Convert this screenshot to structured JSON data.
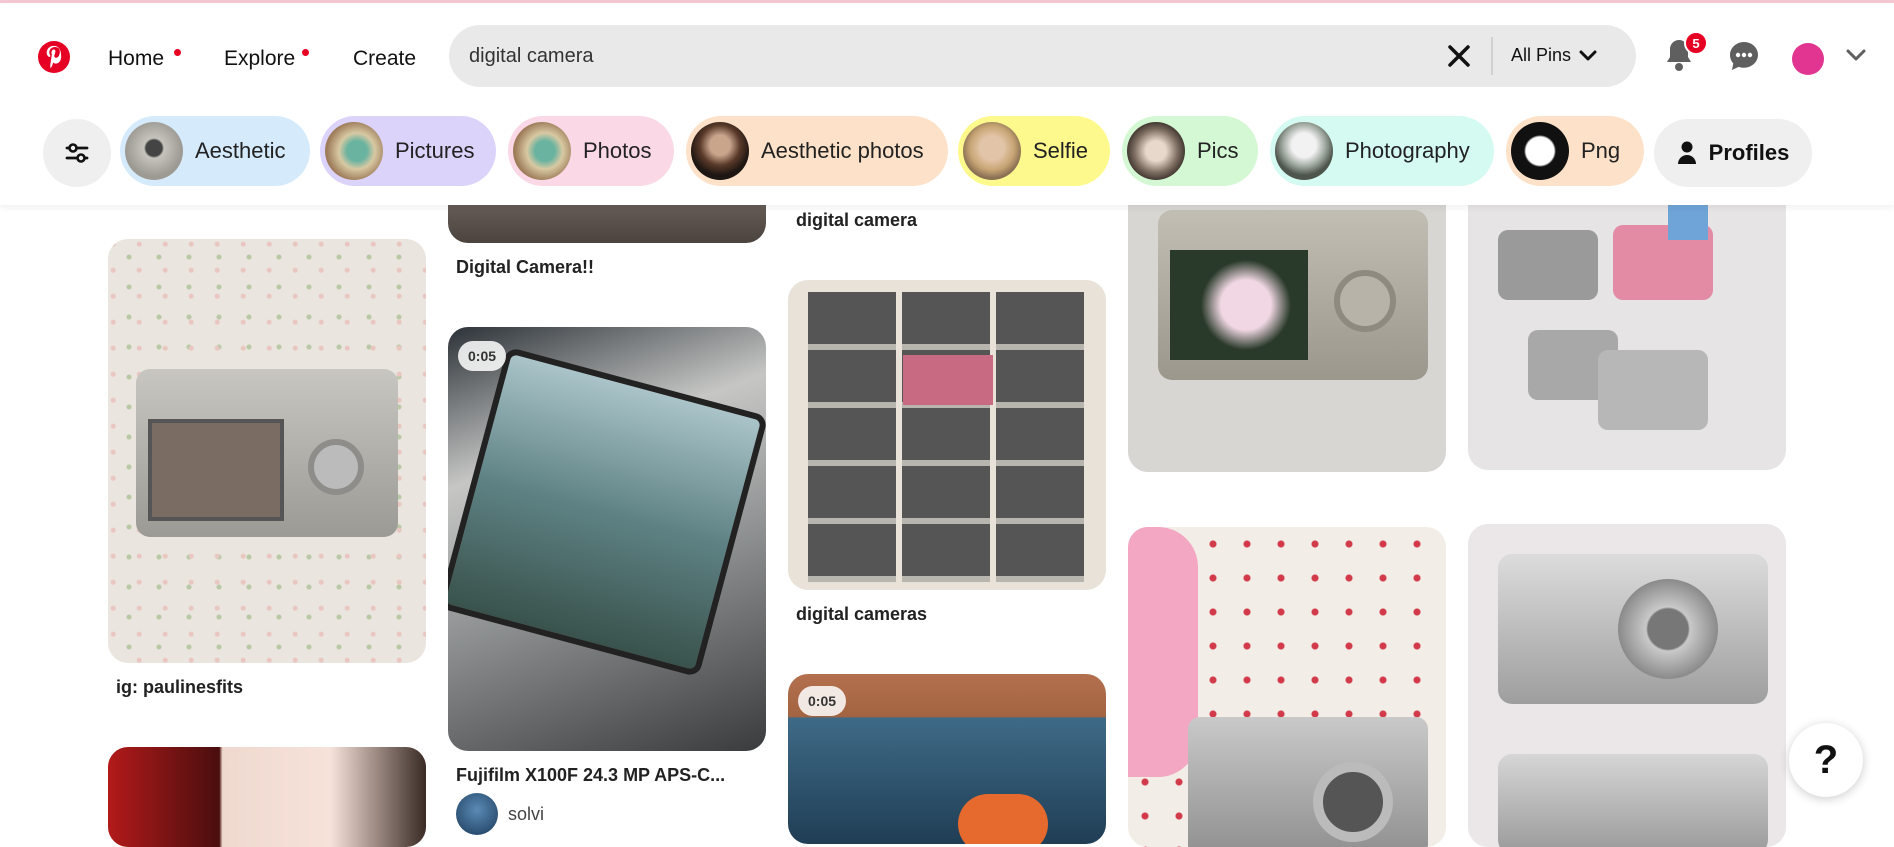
{
  "header": {
    "nav": {
      "home": "Home",
      "explore": "Explore",
      "create": "Create"
    },
    "search": {
      "value": "digital camera",
      "scope": "All Pins"
    },
    "notifications_count": "5"
  },
  "chips": [
    {
      "label": "Aesthetic",
      "bg": "#d5ebfb"
    },
    {
      "label": "Pictures",
      "bg": "#dcd3fb"
    },
    {
      "label": "Photos",
      "bg": "#fbd8e6"
    },
    {
      "label": "Aesthetic photos",
      "bg": "#fde2c9"
    },
    {
      "label": "Selfie",
      "bg": "#fdf98d"
    },
    {
      "label": "Pics",
      "bg": "#d3f8d3"
    },
    {
      "label": "Photography",
      "bg": "#d4faf2"
    },
    {
      "label": "Png",
      "bg": "#fde2c9"
    }
  ],
  "profiles_label": "Profiles",
  "pins": {
    "col1": {
      "caption1": "ig: paulinesfits"
    },
    "col2": {
      "caption_top": "Digital Camera!!",
      "video_time": "0:05",
      "caption2": "Fujifilm X100F 24.3 MP APS-C...",
      "pinner": "solvi"
    },
    "col3": {
      "caption_top": "digital camera",
      "caption2": "digital cameras",
      "video_time": "0:05"
    }
  },
  "help_label": "?",
  "colors": {
    "brand": "#e60023",
    "account": "#e23591"
  }
}
